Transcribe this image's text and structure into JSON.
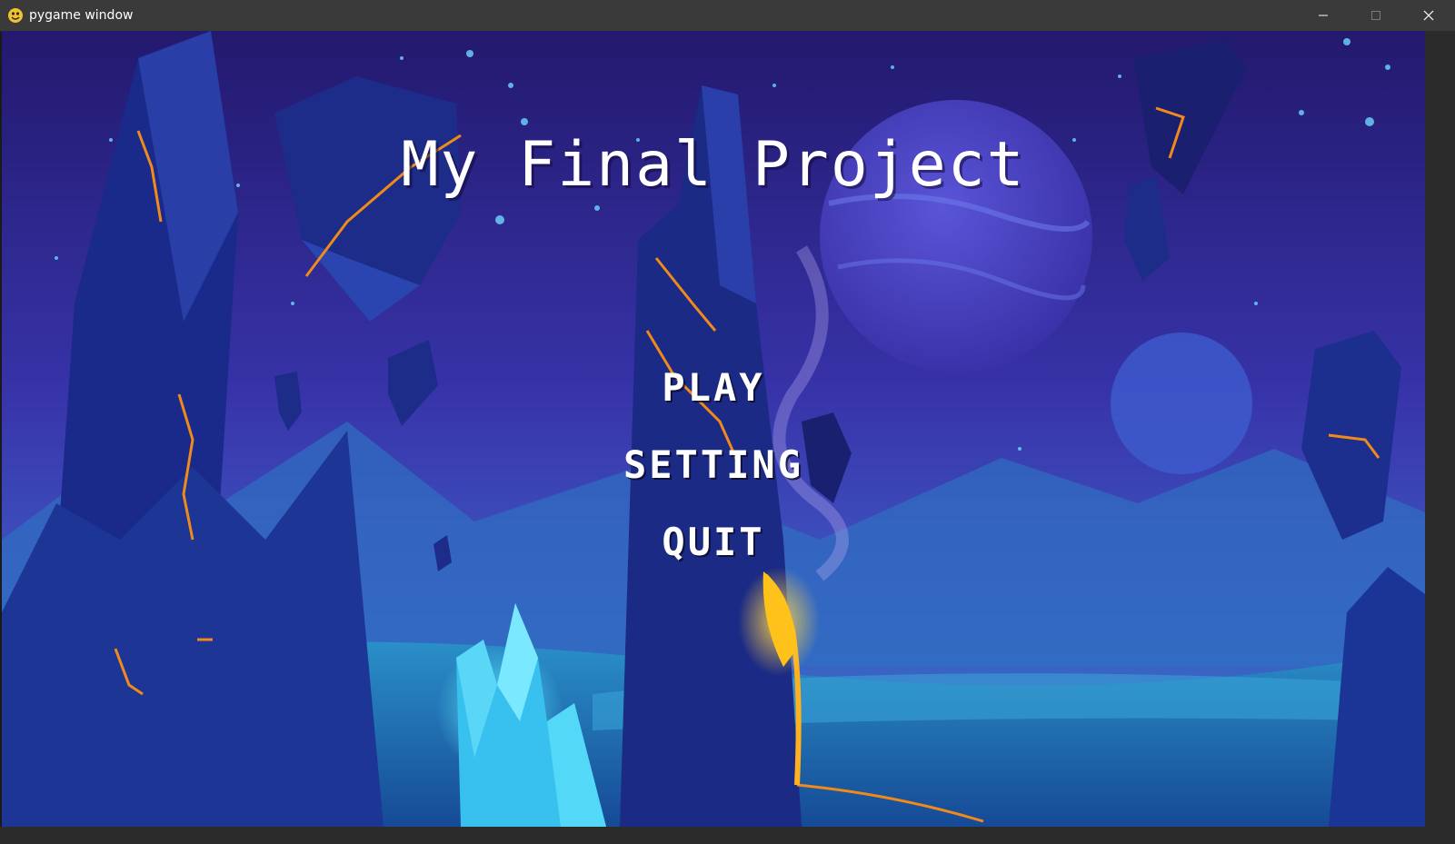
{
  "window": {
    "title": "pygame window",
    "icon": "pygame-snake-icon",
    "controls": [
      "minimize-icon",
      "maximize-icon",
      "close-icon"
    ]
  },
  "menu": {
    "title": "My Final Project",
    "items": [
      {
        "label": "PLAY"
      },
      {
        "label": "SETTING"
      },
      {
        "label": "QUIT"
      }
    ]
  },
  "colors": {
    "titlebar": "#3a3a3a",
    "menu_text": "#ffffff",
    "sky_top": "#2a1f7a",
    "sky_mid": "#3a3fb8",
    "ground": "#1b6fb0",
    "lava": "#f08a1a",
    "crystal": "#4fd6f0"
  }
}
